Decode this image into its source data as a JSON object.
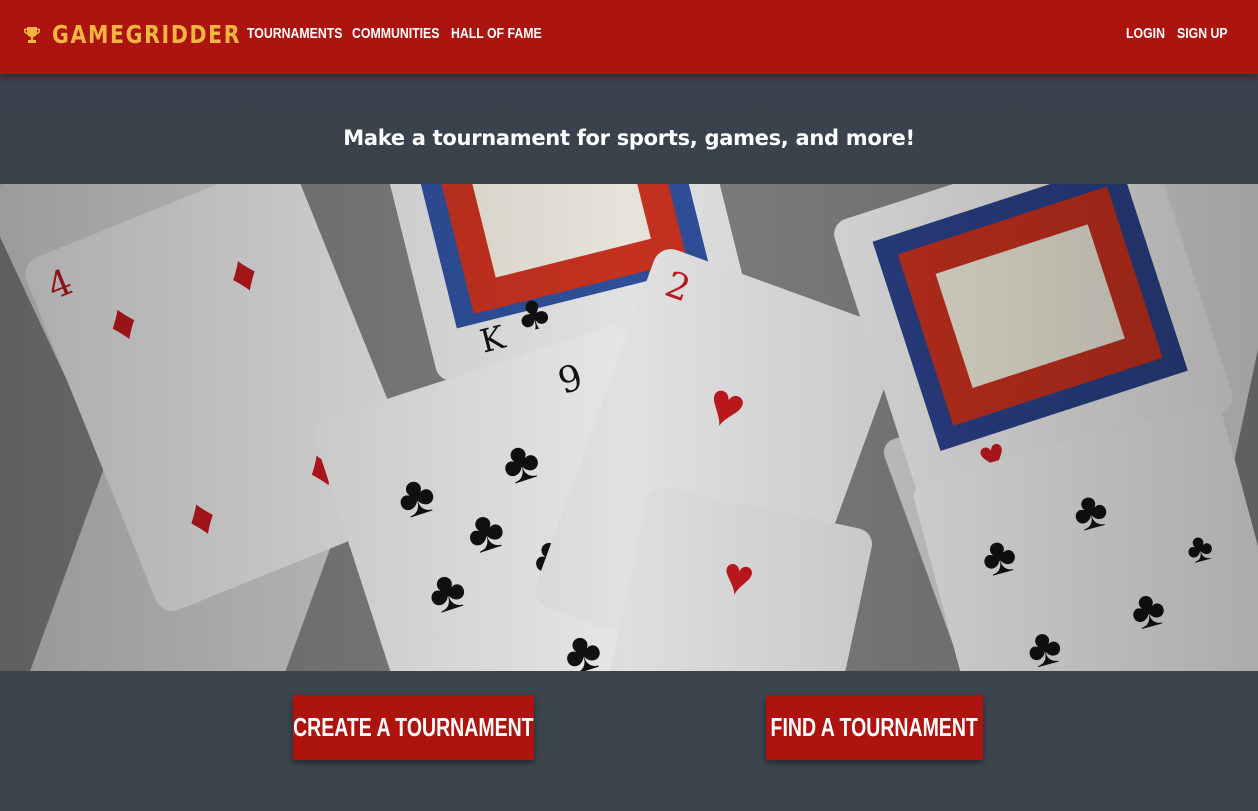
{
  "brand": {
    "name": "GAMEGRIDDER",
    "icon": "trophy-icon",
    "color": "#f2b545"
  },
  "nav": {
    "left": [
      {
        "label": "Tournaments"
      },
      {
        "label": "Communities"
      },
      {
        "label": "Hall of Fame"
      }
    ],
    "right": [
      {
        "label": "Login"
      },
      {
        "label": "Sign Up"
      }
    ]
  },
  "hero": {
    "tagline": "Make a tournament for sports, games, and more!",
    "image": "playing-cards-photo"
  },
  "actions": {
    "create_label": "Create a Tournament",
    "find_label": "Find a Tournament"
  },
  "colors": {
    "primary": "#ad1410",
    "background": "#3a424c",
    "accent": "#f2b545"
  }
}
